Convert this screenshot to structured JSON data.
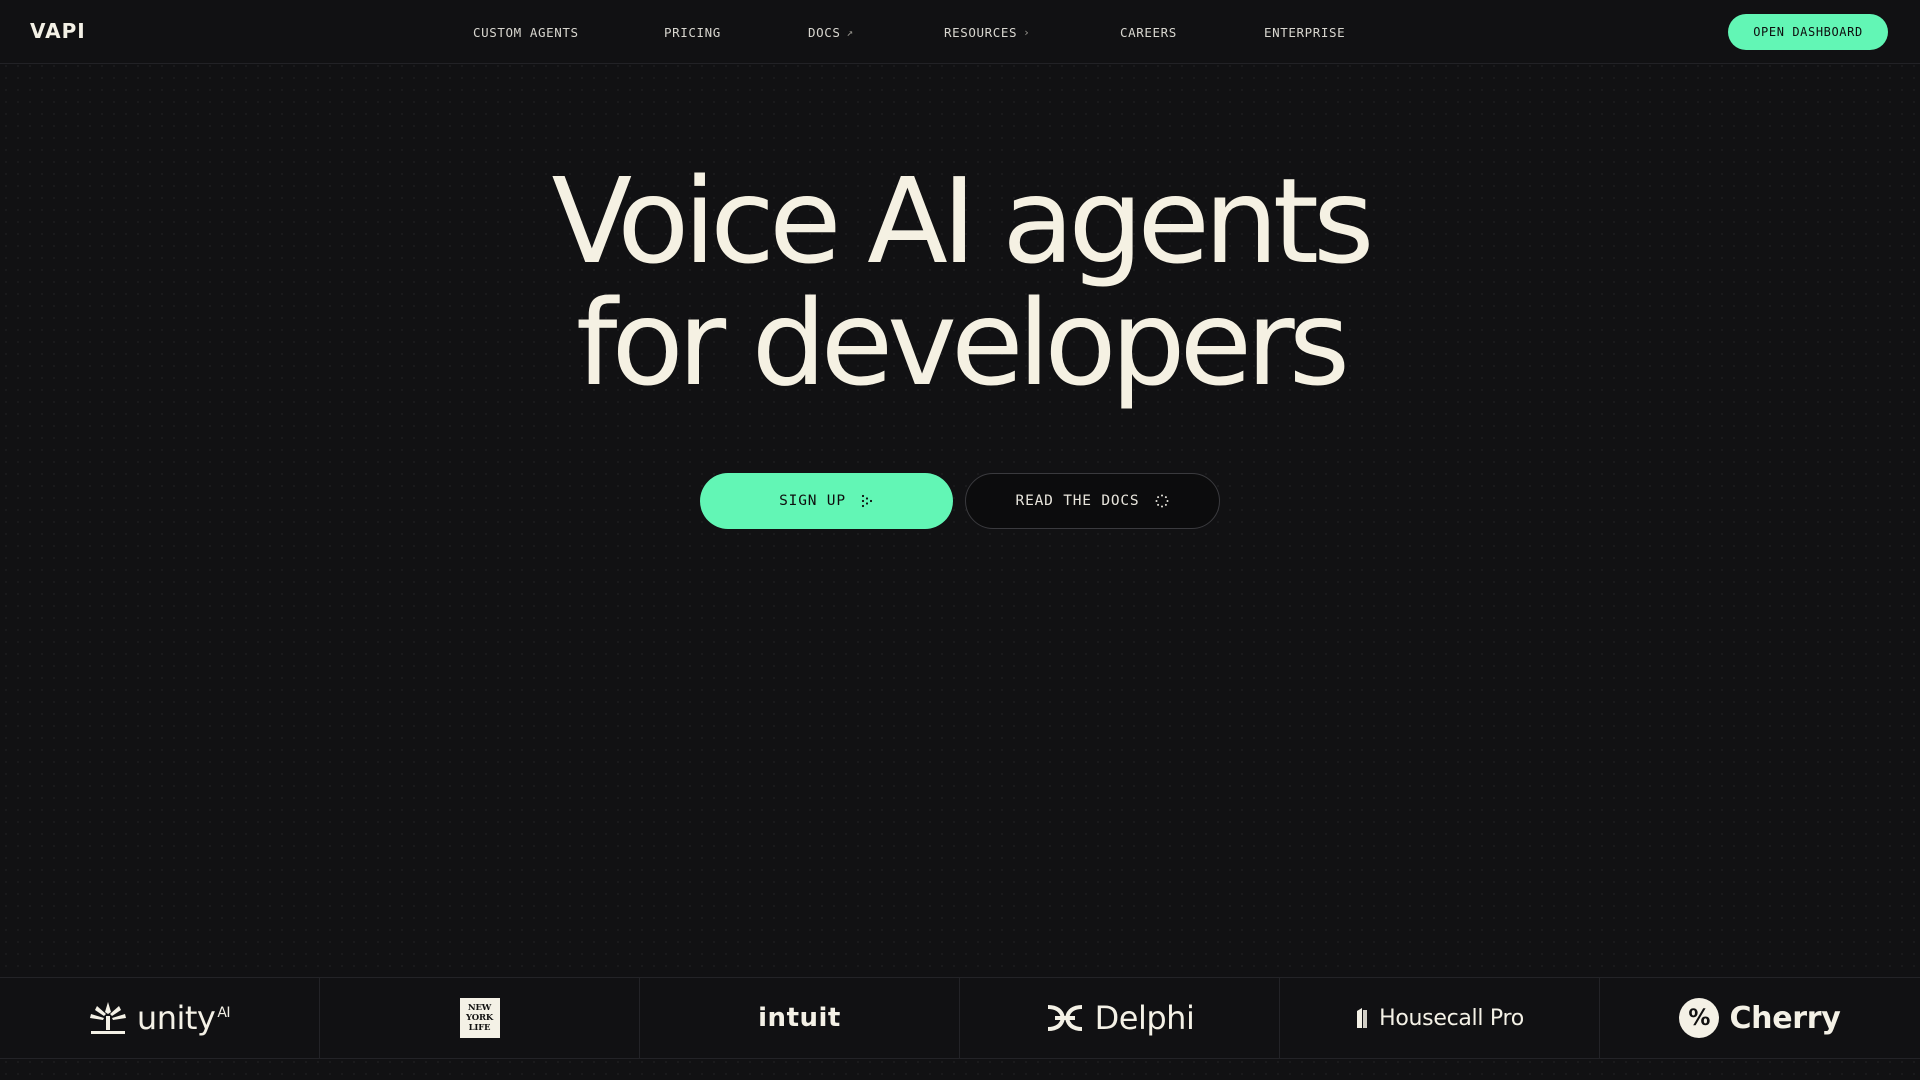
{
  "brand": {
    "logo_text": "VAPI"
  },
  "nav": {
    "links": [
      {
        "label": "CUSTOM AGENTS",
        "icon": ""
      },
      {
        "label": "PRICING",
        "icon": ""
      },
      {
        "label": "DOCS",
        "icon": "↗"
      },
      {
        "label": "RESOURCES",
        "icon": "›"
      },
      {
        "label": "CAREERS",
        "icon": ""
      },
      {
        "label": "ENTERPRISE",
        "icon": ""
      }
    ],
    "cta_label": "OPEN DASHBOARD"
  },
  "hero": {
    "title_line1": "Voice AI agents",
    "title_line2": "for developers",
    "signup_label": "SIGN UP",
    "docs_label": "READ THE DOCS"
  },
  "logos": {
    "unity": {
      "name": "unity",
      "suffix": "AI"
    },
    "nyl": {
      "line1": "NEW",
      "line2": "YORK",
      "line3": "LIFE"
    },
    "intuit": {
      "name": "intuit"
    },
    "delphi": {
      "name": "Delphi"
    },
    "housecall": {
      "name": "Housecall Pro"
    },
    "cherry": {
      "name": "Cherry"
    }
  },
  "colors": {
    "accent": "#62f6b5",
    "background": "#111113",
    "text": "#f5f1e3"
  }
}
